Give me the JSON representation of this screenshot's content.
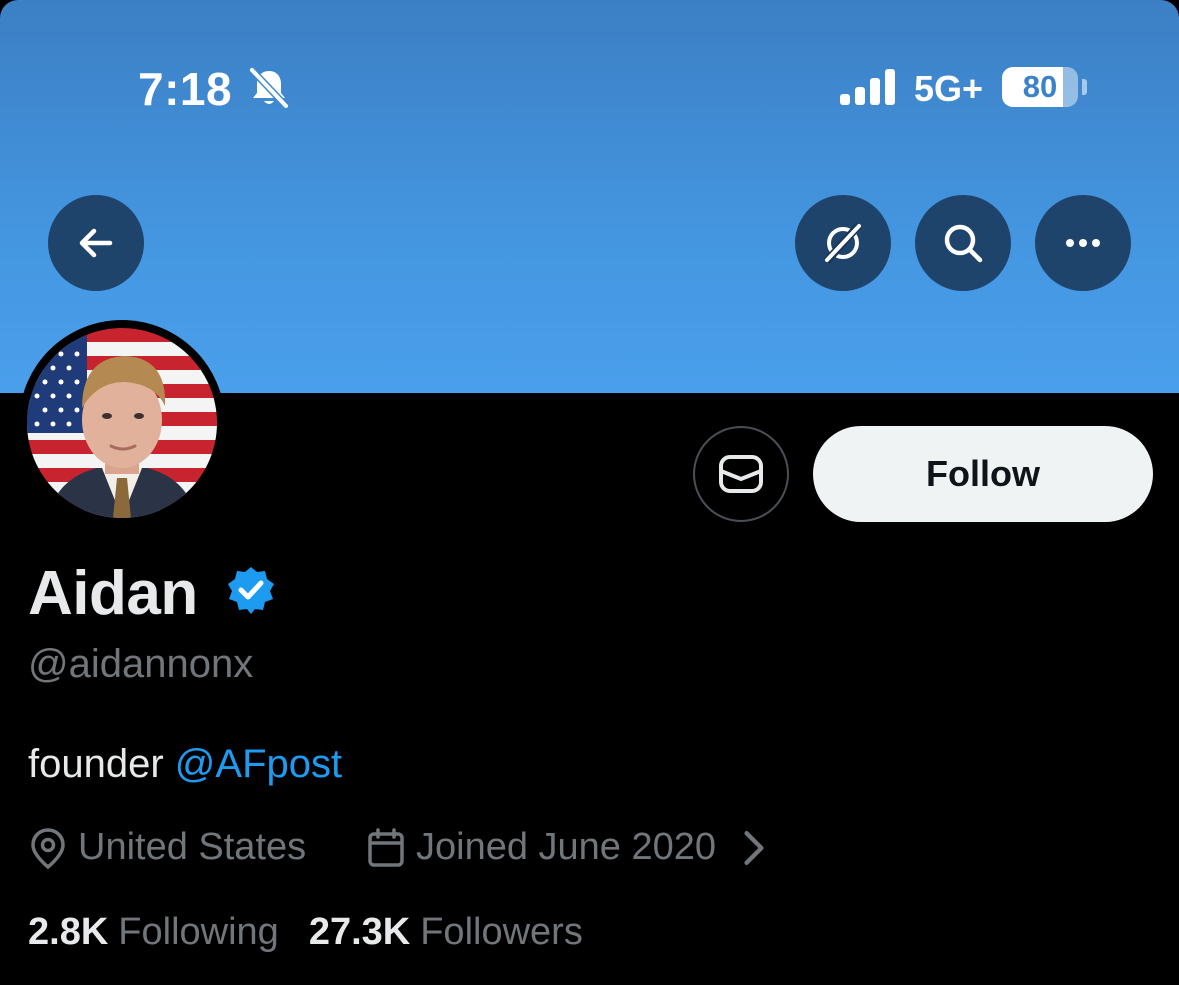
{
  "status_bar": {
    "time": "7:18",
    "network": "5G+",
    "battery": "80",
    "battery_level": 0.8
  },
  "icons": {
    "back": "arrow-left-icon",
    "grok": "grok-icon",
    "search": "search-icon",
    "more": "more-dots-icon",
    "message": "message-icon",
    "location": "location-pin-icon",
    "calendar": "calendar-icon",
    "verified": "verified-badge-icon"
  },
  "colors": {
    "banner": "#4496e0",
    "link": "#1d9bf0",
    "verified": "#1d9bf0",
    "text_primary": "#e7e9ea",
    "text_secondary": "#71767b"
  },
  "profile": {
    "display_name": "Aidan",
    "handle": "@aidannonx",
    "bio_prefix": "founder ",
    "bio_link": "@AFpost",
    "location": "United States",
    "joined": "Joined June 2020"
  },
  "actions": {
    "follow_label": "Follow"
  },
  "stats": {
    "following_count": "2.8K",
    "following_label": "Following",
    "followers_count": "27.3K",
    "followers_label": "Followers"
  }
}
